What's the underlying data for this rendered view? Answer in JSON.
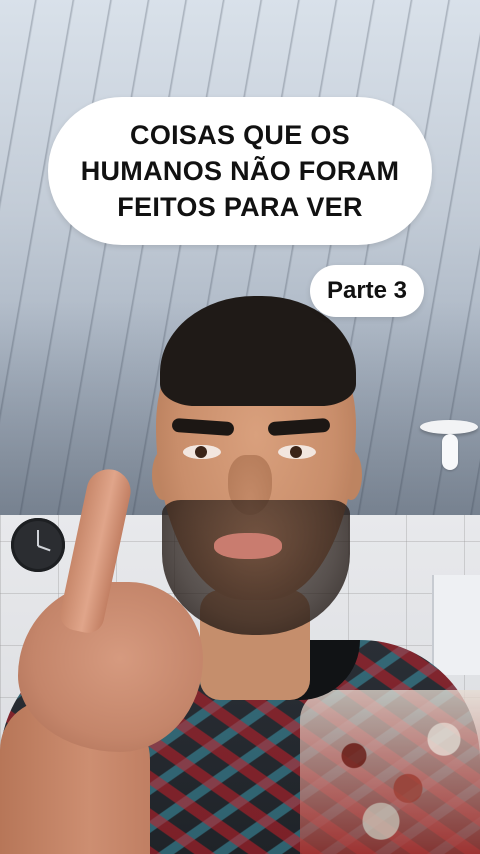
{
  "overlay": {
    "title_lines": [
      "COISAS QUE OS",
      "HUMANOS NÃO FORAM",
      "FEITOS PARA VER"
    ],
    "part_label": "Parte 3"
  },
  "colors": {
    "bubble_bg": "#ffffff",
    "text": "#111111"
  }
}
